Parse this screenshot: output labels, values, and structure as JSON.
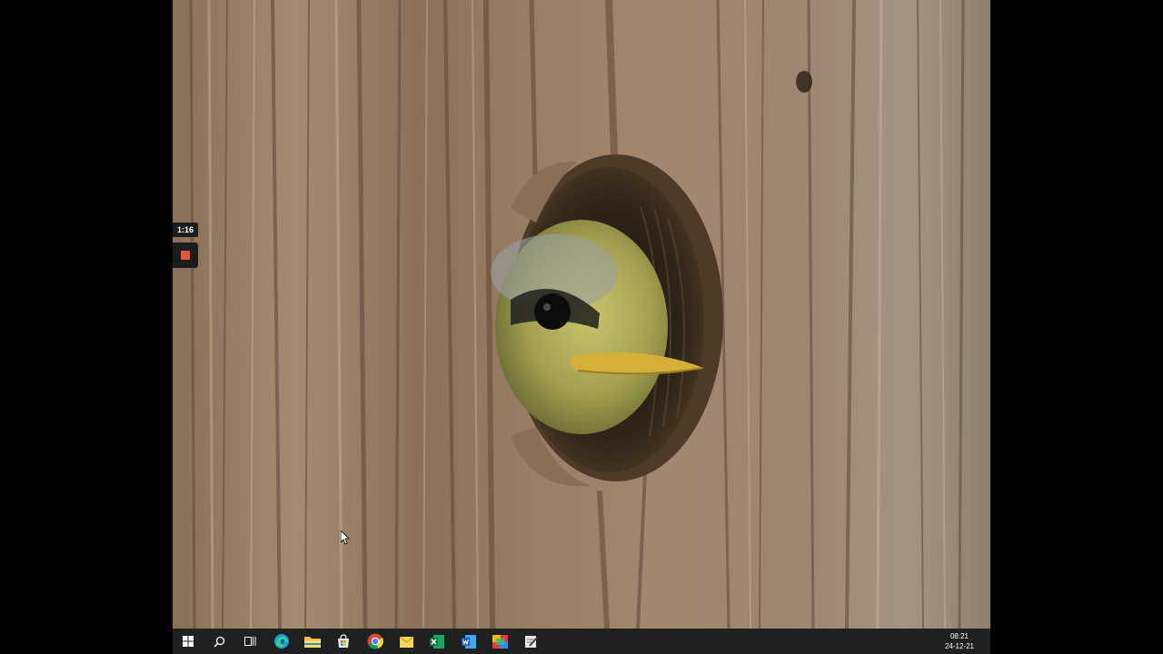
{
  "recorder": {
    "elapsed": "1:16",
    "stop_color": "#e5533a"
  },
  "wallpaper": {
    "subject": "young blue tit peeking from a hole in a weathered wooden nest box"
  },
  "taskbar": {
    "icons": [
      "windows-start-icon",
      "search-icon",
      "task-view-icon",
      "edge-icon",
      "file-explorer-icon",
      "microsoft-store-icon",
      "chrome-icon",
      "sticky-notes-icon",
      "excel-icon",
      "word-icon",
      "paint-icon",
      "notepad-icon"
    ],
    "clock": {
      "time": "08:21",
      "date": "24-12-21"
    }
  }
}
